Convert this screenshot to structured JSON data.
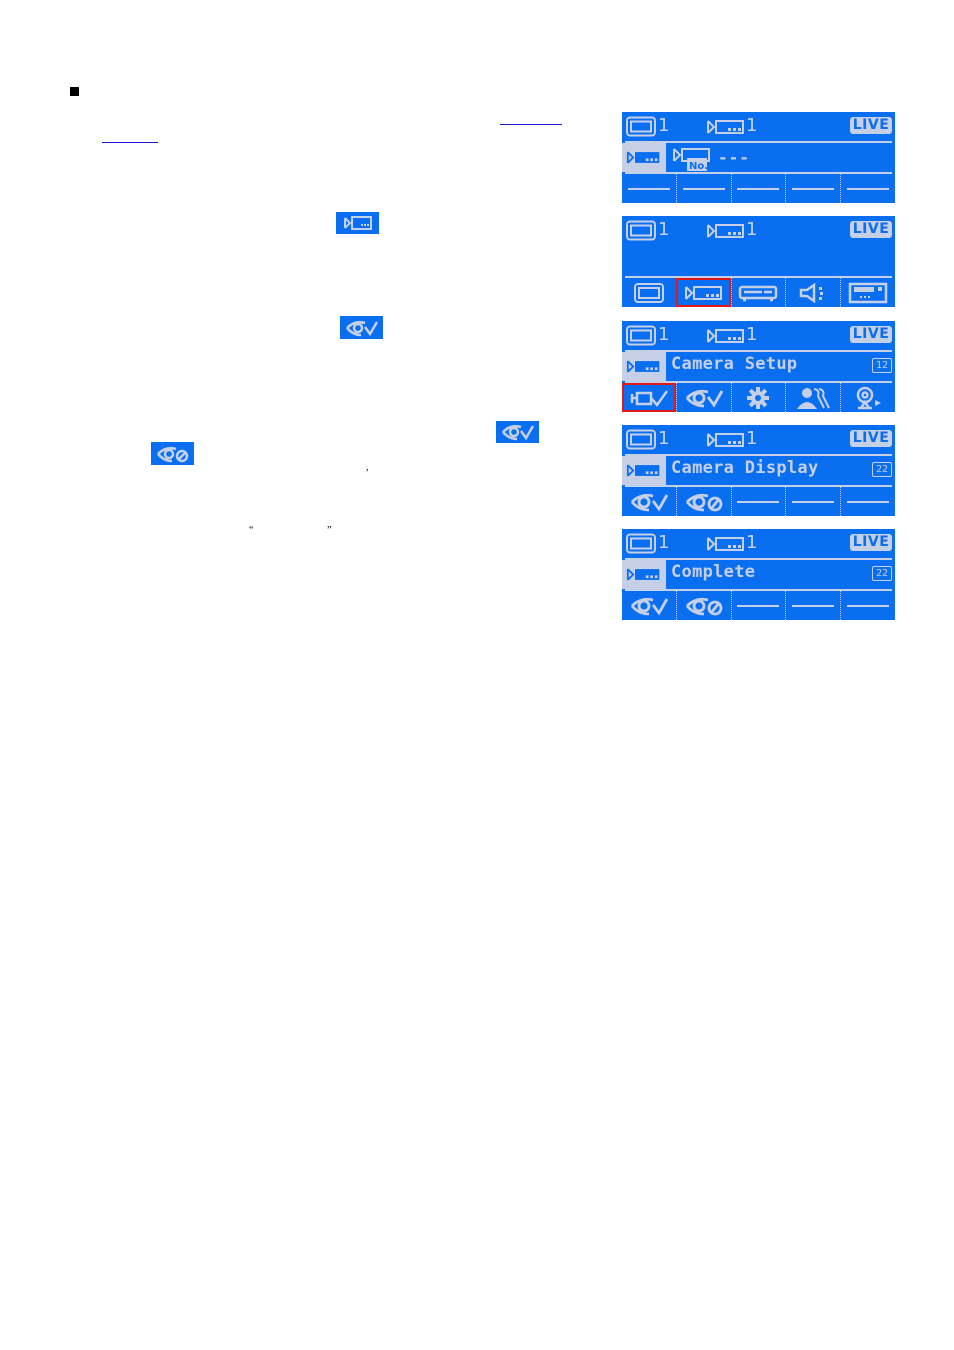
{
  "document": {
    "punctuation": {
      "comma": ",",
      "open_quote": "“",
      "close_quote": "”"
    },
    "inline_icons": [
      {
        "name": "camera-icon"
      },
      {
        "name": "camera-display-icon"
      },
      {
        "name": "camera-display-icon"
      },
      {
        "name": "camera-hide-icon"
      }
    ]
  },
  "screens": [
    {
      "monitor_num": "1",
      "camera_num": "1",
      "live_label": "LIVE",
      "title": "---",
      "mode": "camera-no",
      "bottom": [
        "dash",
        "dash",
        "dash",
        "dash",
        "dash"
      ]
    },
    {
      "monitor_num": "1",
      "camera_num": "1",
      "live_label": "LIVE",
      "title": "",
      "bottom": [
        "monitor",
        "camera",
        "dvr",
        "speaker",
        "keypad"
      ],
      "selected_index": 1
    },
    {
      "monitor_num": "1",
      "camera_num": "1",
      "live_label": "LIVE",
      "title": "Camera Setup",
      "badge": "12",
      "bottom": [
        "camera-setup",
        "camera-display",
        "gear",
        "users",
        "webcam"
      ],
      "selected_index": 0
    },
    {
      "monitor_num": "1",
      "camera_num": "1",
      "live_label": "LIVE",
      "title": "Camera Display",
      "badge": "22",
      "bottom": [
        "camera-display",
        "camera-hide",
        "dash",
        "dash",
        "dash"
      ]
    },
    {
      "monitor_num": "1",
      "camera_num": "1",
      "live_label": "LIVE",
      "title": "Complete",
      "badge": "22",
      "bottom": [
        "camera-display",
        "camera-hide",
        "dash",
        "dash",
        "dash"
      ]
    }
  ],
  "colors": {
    "lcd_bg": "#0a6ef0",
    "lcd_fg": "#c5cfe6",
    "selection": "#e01a1a",
    "link": "#1a1ad0"
  }
}
